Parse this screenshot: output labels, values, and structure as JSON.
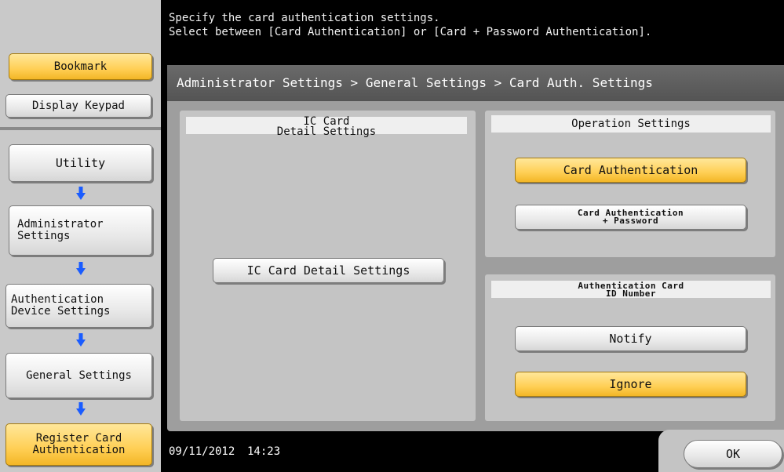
{
  "sidebar": {
    "bookmark_label": "Bookmark",
    "display_keypad_label": "Display Keypad",
    "nav": [
      {
        "label": "Utility"
      },
      {
        "label": "Administrator\nSettings"
      },
      {
        "label": "Authentication\nDevice Settings"
      },
      {
        "label": "General Settings"
      },
      {
        "label": "Register Card\nAuthentication"
      }
    ],
    "arrow_icon": "arrow-down-icon"
  },
  "header": {
    "message": "Specify the card authentication settings.\nSelect between [Card Authentication] or [Card + Password Authentication]."
  },
  "breadcrumb": "Administrator Settings > General Settings > Card Auth. Settings",
  "left_panel": {
    "heading": "IC Card\nDetail Settings",
    "button_label": "IC Card Detail Settings"
  },
  "operation": {
    "heading": "Operation Settings",
    "card_auth_label": "Card Authentication",
    "card_auth_password_label": "Card Authentication\n+ Password",
    "selected": "Card Authentication"
  },
  "id_number": {
    "heading": "Authentication Card\nID Number",
    "notify_label": "Notify",
    "ignore_label": "Ignore",
    "selected": "Ignore"
  },
  "footer": {
    "date": "09/11/2012",
    "time": "14:23",
    "ok_label": "OK"
  },
  "colors": {
    "selected": "#ffcf55",
    "header_bg": "#000000",
    "panel_bg": "#9e9e9e"
  }
}
